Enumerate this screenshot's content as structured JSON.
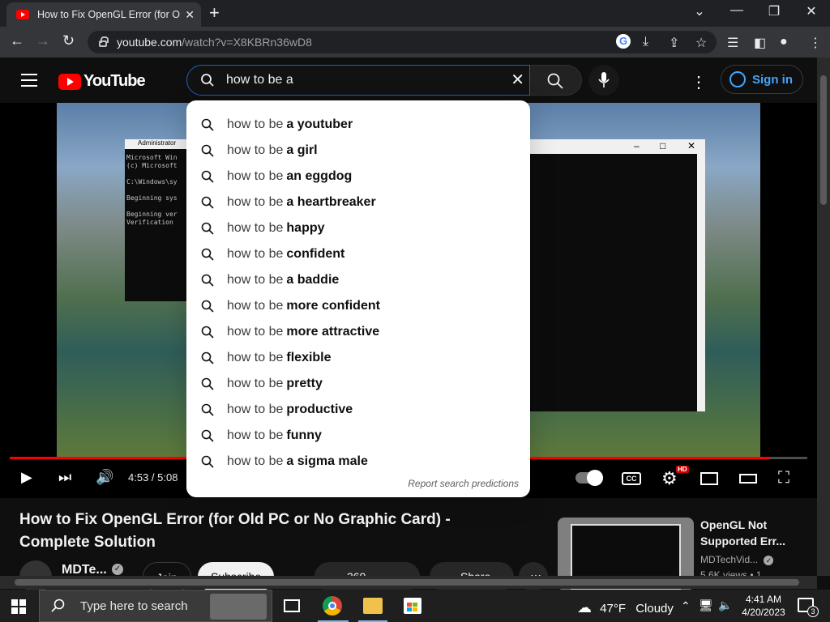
{
  "browser": {
    "tab_title": "How to Fix OpenGL Error (for Old",
    "url_host": "youtube.com",
    "url_path": "/watch?v=X8KBRn36wD8"
  },
  "masthead": {
    "logo_text": "YouTube",
    "search_value": "how to be a",
    "signin_label": "Sign in"
  },
  "suggestions": {
    "prefix": "how to be",
    "items": [
      "a youtuber",
      "a girl",
      "an eggdog",
      "a heartbreaker",
      "happy",
      "confident",
      "a baddie",
      "more confident",
      "more attractive",
      "flexible",
      "pretty",
      "productive",
      "funny",
      "a sigma male"
    ],
    "report_label": "Report search predictions"
  },
  "player": {
    "time": "4:53 / 5:08",
    "progress": 0.952,
    "cmd_title": "Administrator",
    "cmd_lines": [
      "Microsoft Win",
      "(c) Microsoft",
      "",
      "C:\\Windows\\sy",
      "",
      "Beginning sys",
      "",
      "Beginning ver",
      "Verification"
    ],
    "settings_badge": "HD"
  },
  "video": {
    "title": "How to Fix OpenGL Error (for Old PC or No Graphic Card) - Complete Solution",
    "channel": "MDTe...",
    "join_label": "Join",
    "subscribe_label": "Subscribe",
    "likes": "369",
    "share_label": "Share"
  },
  "recommended": {
    "title": "OpenGL Not Supported Err...",
    "channel": "MDTechVid...",
    "views": "5.6K views • 1"
  },
  "taskbar": {
    "search_placeholder": "Type here to search",
    "weather_temp": "47°F",
    "weather_desc": "Cloudy",
    "time": "4:41 AM",
    "date": "4/20/2023",
    "notif_count": "3"
  }
}
